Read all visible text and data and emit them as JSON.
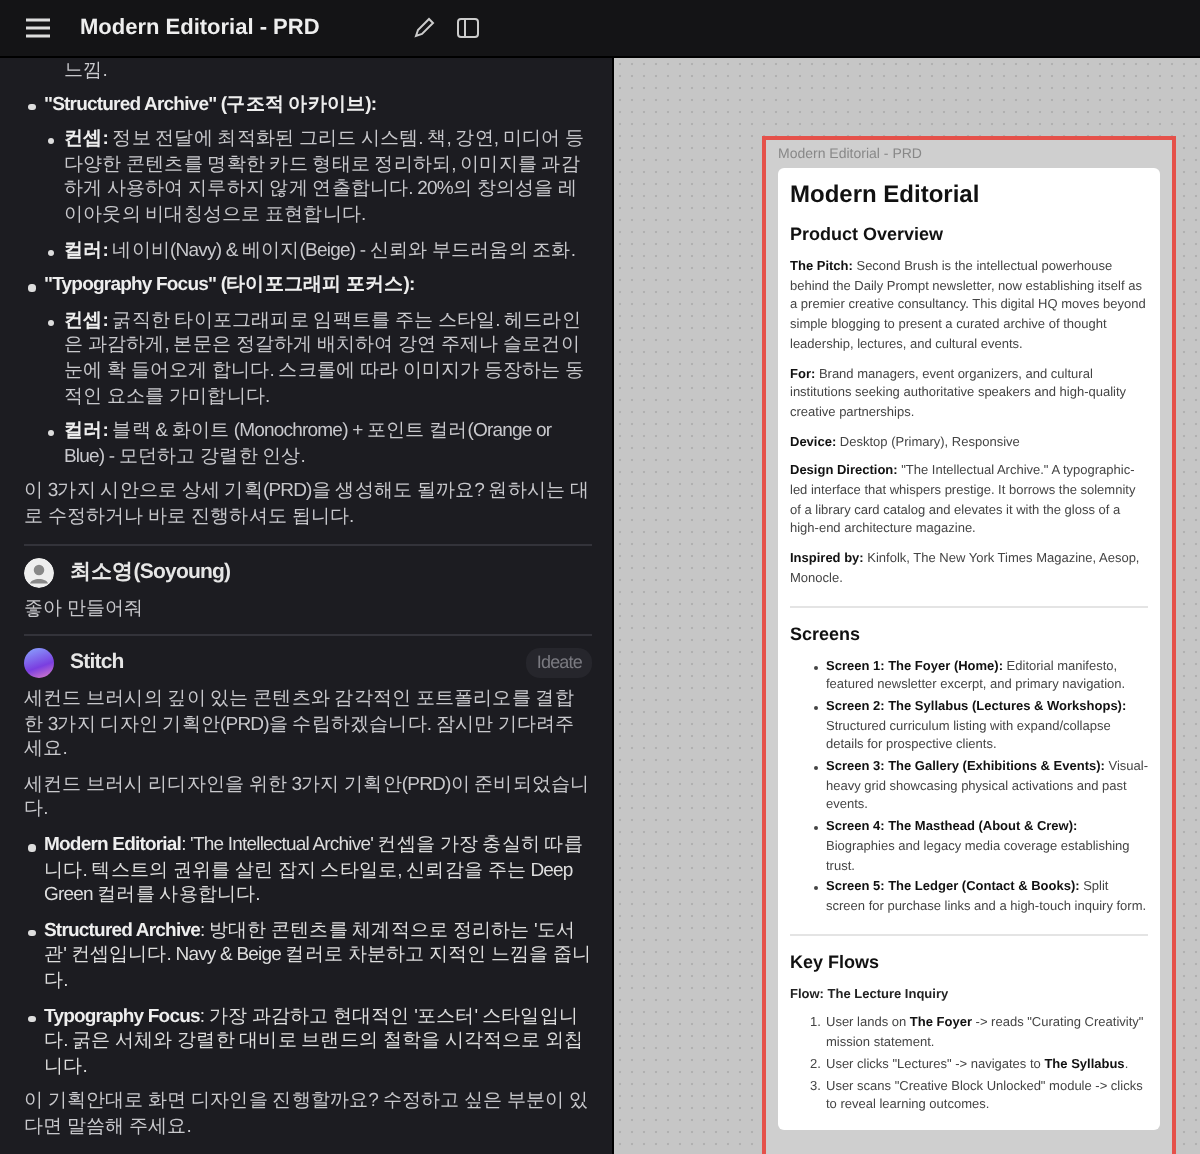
{
  "header": {
    "title": "Modern Editorial - PRD"
  },
  "chat": {
    "cut_line": "느낌.",
    "concepts": [
      {
        "title": "\"Structured Archive\" (구조적 아카이브):",
        "points": [
          "**컨셉:** 정보 전달에 최적화된 그리드 시스템. 책, 강연, 미디어 등 다양한 콘텐츠를 명확한 카드 형태로 정리하되, 이미지를 과감하게 사용하여 지루하지 않게 연출합니다. 20%의 창의성을 레이아웃의 비대칭성으로 표현합니다.",
          "**컬러:** 네이비(Navy) & 베이지(Beige) - 신뢰와 부드러움의 조화."
        ]
      },
      {
        "title": "\"Typography Focus\" (타이포그래피 포커스):",
        "points": [
          "**컨셉:** 굵직한 타이포그래피로 임팩트를 주는 스타일. 헤드라인은 과감하게, 본문은 정갈하게 배치하여 강연 주제나 슬로건이 눈에 확 들어오게 합니다. 스크롤에 따라 이미지가 등장하는 동적인 요소를 가미합니다.",
          "**컬러:** 블랙 & 화이트 (Monochrome) + 포인트 컬러(Orange or Blue) - 모던하고 강렬한 인상."
        ]
      }
    ],
    "question": "이 3가지 시안으로 상세 기획(PRD)을 생성해도 될까요? 원하시는 대로 수정하거나 바로 진행하셔도 됩니다.",
    "messages": [
      {
        "kind": "user",
        "author": "최소영(Soyoung)",
        "paragraphs": [
          "좋아 만들어줘"
        ]
      },
      {
        "kind": "agent",
        "author": "Stitch",
        "badge": "Ideate",
        "paragraphs": [
          "세컨드 브러시의 깊이 있는 콘텐츠와 감각적인 포트폴리오를 결합한 3가지 디자인 기획안(PRD)을 수립하겠습니다. 잠시만 기다려주세요.",
          "세컨드 브러시 리디자인을 위한 3가지 기획안(PRD)이 준비되었습니다."
        ],
        "bullets": [
          "**Modern Editorial**: 'The Intellectual Archive' 컨셉을 가장 충실히 따릅니다. 텍스트의 권위를 살린 잡지 스타일로, 신뢰감을 주는 Deep Green 컬러를 사용합니다.",
          "**Structured Archive**: 방대한 콘텐츠를 체계적으로 정리하는 '도서관' 컨셉입니다. Navy & Beige 컬러로 차분하고 지적인 느낌을 줍니다.",
          "**Typography Focus**: 가장 과감하고 현대적인 '포스터' 스타일입니다. 굵은 서체와 강렬한 대비로 브랜드의 철학을 시각적으로 외칩니다."
        ],
        "closing": "이 기획안대로 화면 디자인을 진행할까요? 수정하고 싶은 부분이 있다면 말씀해 주세요."
      }
    ]
  },
  "preview": {
    "frame_label": "Modern Editorial - PRD",
    "doc": {
      "title": "Modern Editorial",
      "sections": [
        {
          "kind": "paragraphs",
          "heading": "Product Overview",
          "items": [
            "**The Pitch:** Second Brush is the intellectual powerhouse behind the Daily Prompt newsletter, now establishing itself as a premier creative consultancy. This digital HQ moves beyond simple blogging to present a curated archive of thought leadership, lectures, and cultural events.",
            "**For:** Brand managers, event organizers, and cultural institutions seeking authoritative speakers and high-quality creative partnerships.",
            "**Device:** Desktop (Primary), Responsive",
            "**Design Direction:** \"The Intellectual Archive.\" A typographic-led interface that whispers prestige. It borrows the solemnity of a library card catalog and elevates it with the gloss of a high-end architecture magazine.",
            "**Inspired by:** Kinfolk, The New York Times Magazine, Aesop, Monocle."
          ]
        },
        {
          "kind": "bullets",
          "heading": "Screens",
          "items": [
            "**Screen 1: The Foyer (Home):** Editorial manifesto, featured newsletter excerpt, and primary navigation.",
            "**Screen 2: The Syllabus (Lectures & Workshops):** Structured curriculum listing with expand/collapse details for prospective clients.",
            "**Screen 3: The Gallery (Exhibitions & Events):** Visual-heavy grid showcasing physical activations and past events.",
            "**Screen 4: The Masthead (About & Crew):** Biographies and legacy media coverage establishing trust.",
            "**Screen 5: The Ledger (Contact & Books):** Split screen for purchase links and a high-touch inquiry form."
          ]
        },
        {
          "kind": "steps",
          "heading": "Key Flows",
          "subheading": "Flow: The Lecture Inquiry",
          "items": [
            {
              "number": "1.",
              "text": "User lands on **The Foyer** -> reads \"Curating Creativity\" mission statement."
            },
            {
              "number": "2.",
              "text": "User clicks \"Lectures\" -> navigates to **The Syllabus**."
            },
            {
              "number": "3.",
              "text": "User scans \"Creative Block Unlocked\" module -> clicks to reveal learning outcomes."
            }
          ]
        }
      ]
    }
  }
}
